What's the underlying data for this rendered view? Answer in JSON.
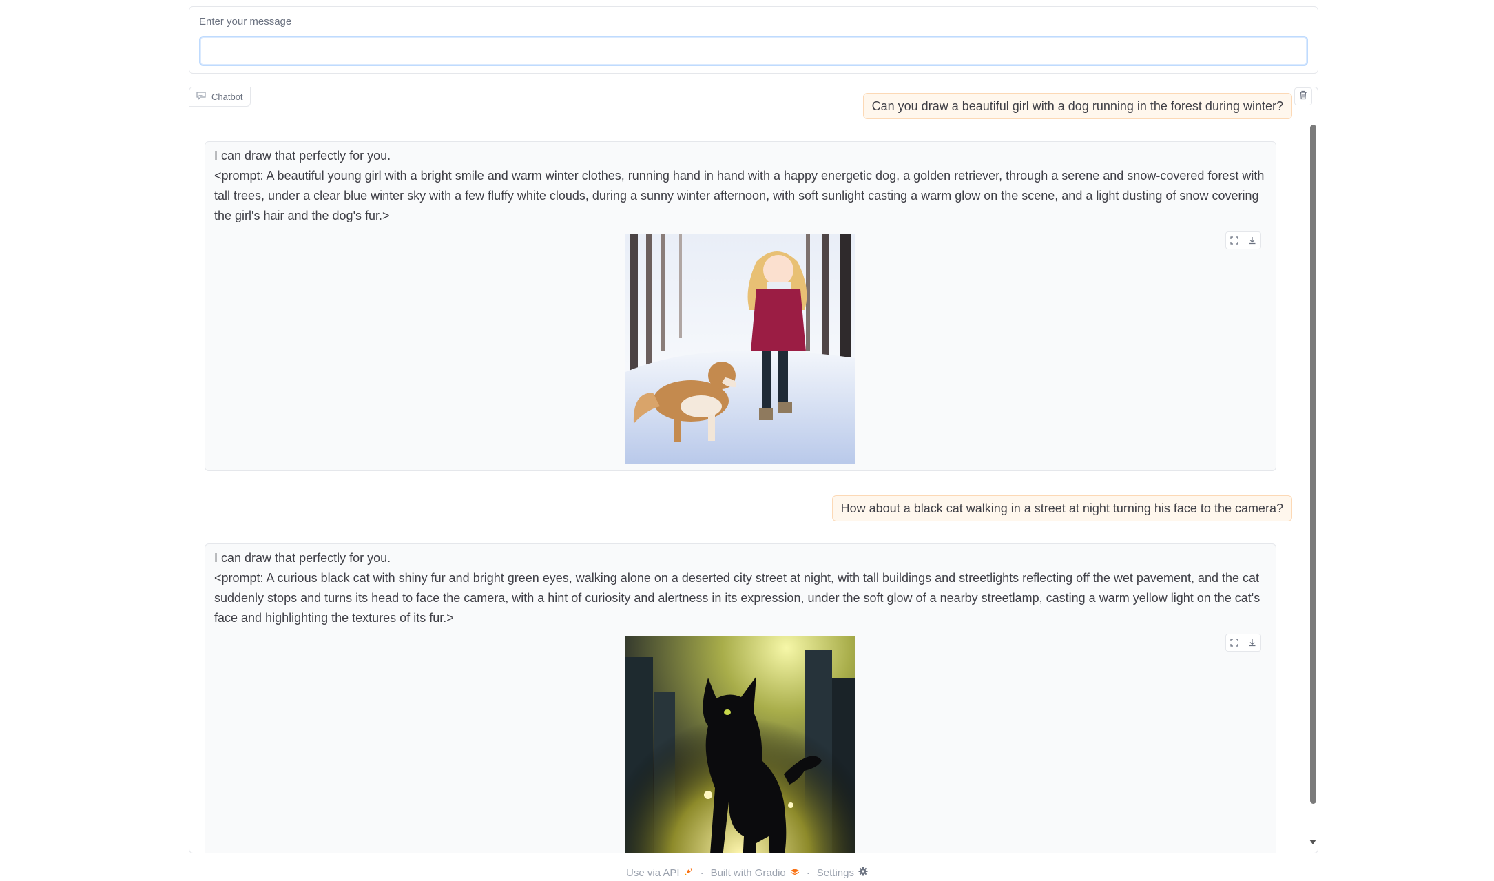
{
  "input": {
    "label": "Enter your message",
    "value": "",
    "placeholder": ""
  },
  "chat": {
    "label": "Chatbot",
    "messages": [
      {
        "role": "user",
        "text": "Can you draw a beautiful girl with a dog running in the forest during winter?"
      },
      {
        "role": "bot",
        "line1": "I can draw that perfectly for you.",
        "line2": "<prompt: A beautiful young girl with a bright smile and warm winter clothes, running hand in hand with a happy energetic dog, a golden retriever, through a serene and snow-covered forest with tall trees, under a clear blue winter sky with a few fluffy white clouds, during a sunny winter afternoon, with soft sunlight casting a warm glow on the scene, and a light dusting of snow covering the girl's hair and the dog's fur.>",
        "image": "girl-and-dog-in-snowy-forest"
      },
      {
        "role": "user",
        "text": "How about a black cat walking in a street at night turning his face to the camera?"
      },
      {
        "role": "bot",
        "line1": "I can draw that perfectly for you.",
        "line2": "<prompt: A curious black cat with shiny fur and bright green eyes, walking alone on a deserted city street at night, with tall buildings and streetlights reflecting off the wet pavement, and the cat suddenly stops and turns its head to face the camera, with a hint of curiosity and alertness in its expression, under the soft glow of a nearby streetlamp, casting a warm yellow light on the cat's face and highlighting the textures of its fur.>",
        "image": "black-cat-on-night-street"
      }
    ]
  },
  "footer": {
    "api": "Use via API",
    "built": "Built with Gradio",
    "settings": "Settings",
    "separator": "·"
  },
  "colors": {
    "user_bubble": "#fff7ed",
    "bot_bubble": "#f9fafb",
    "input_focus": "#bfdbfe"
  }
}
